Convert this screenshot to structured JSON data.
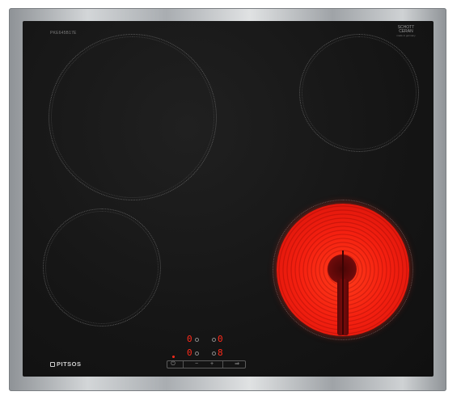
{
  "model_text": "PKE645B17E",
  "badge": {
    "line1": "SCHOTT",
    "line2": "CERAN",
    "line3": "made in germany"
  },
  "brand": "PITSOS",
  "displays": [
    {
      "id": "display-top-left",
      "value": "0"
    },
    {
      "id": "display-top-right",
      "value": "0"
    },
    {
      "id": "display-bottom-left",
      "value": "0"
    },
    {
      "id": "display-bottom-right",
      "value": "8"
    }
  ],
  "controls": {
    "power_symbol": "⏻",
    "minus_symbol": "−",
    "plus_symbol": "+",
    "next_symbol": "⇒"
  },
  "colors": {
    "glass": "#151515",
    "active_zone": "#f42010",
    "display_red": "#ff2a1a",
    "frame": "#c2c5c8"
  }
}
